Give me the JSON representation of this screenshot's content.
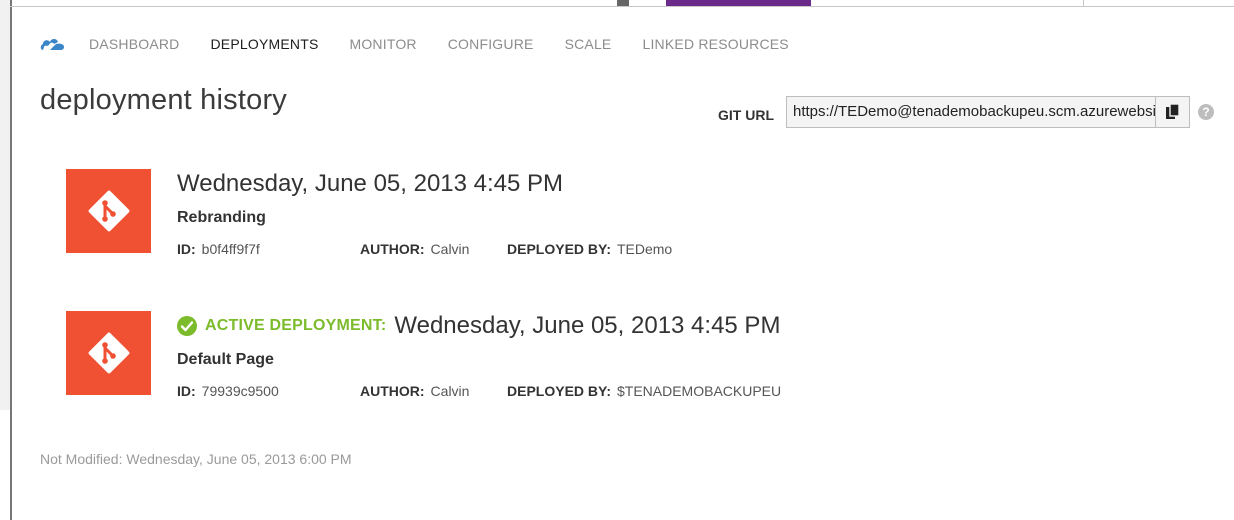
{
  "nav": {
    "items": [
      {
        "label": "DASHBOARD",
        "active": false
      },
      {
        "label": "DEPLOYMENTS",
        "active": true
      },
      {
        "label": "MONITOR",
        "active": false
      },
      {
        "label": "CONFIGURE",
        "active": false
      },
      {
        "label": "SCALE",
        "active": false
      },
      {
        "label": "LINKED RESOURCES",
        "active": false
      }
    ]
  },
  "page_title": "deployment history",
  "git": {
    "label": "GIT URL",
    "value": "https://TEDemo@tenademobackupeu.scm.azurewebsites.net/tenademobackupeu.git"
  },
  "deployments": [
    {
      "title": "Wednesday, June 05, 2013 4:45 PM",
      "message": "Rebranding",
      "id_label": "ID:",
      "id": "b0f4ff9f7f",
      "author_label": "AUTHOR:",
      "author": "Calvin",
      "deployed_by_label": "DEPLOYED BY:",
      "deployed_by": "TEDemo"
    },
    {
      "active_label": "ACTIVE DEPLOYMENT:",
      "title": "Wednesday, June 05, 2013 4:45 PM",
      "message": "Default Page",
      "id_label": "ID:",
      "id": "79939c9500",
      "author_label": "AUTHOR:",
      "author": "Calvin",
      "deployed_by_label": "DEPLOYED BY:",
      "deployed_by": "$TENADEMOBACKUPEU"
    }
  ],
  "footer_note": "Not Modified: Wednesday, June 05, 2013 6:00 PM",
  "colors": {
    "git_orange": "#f05133",
    "active_green": "#7cbb2b",
    "azure_blue": "#3a86c8"
  },
  "icons": {
    "logo": "azure-cloud-icon",
    "deploy": "git-logo-icon",
    "copy": "copy-icon",
    "help": "help-icon",
    "active": "check-circle-icon"
  }
}
